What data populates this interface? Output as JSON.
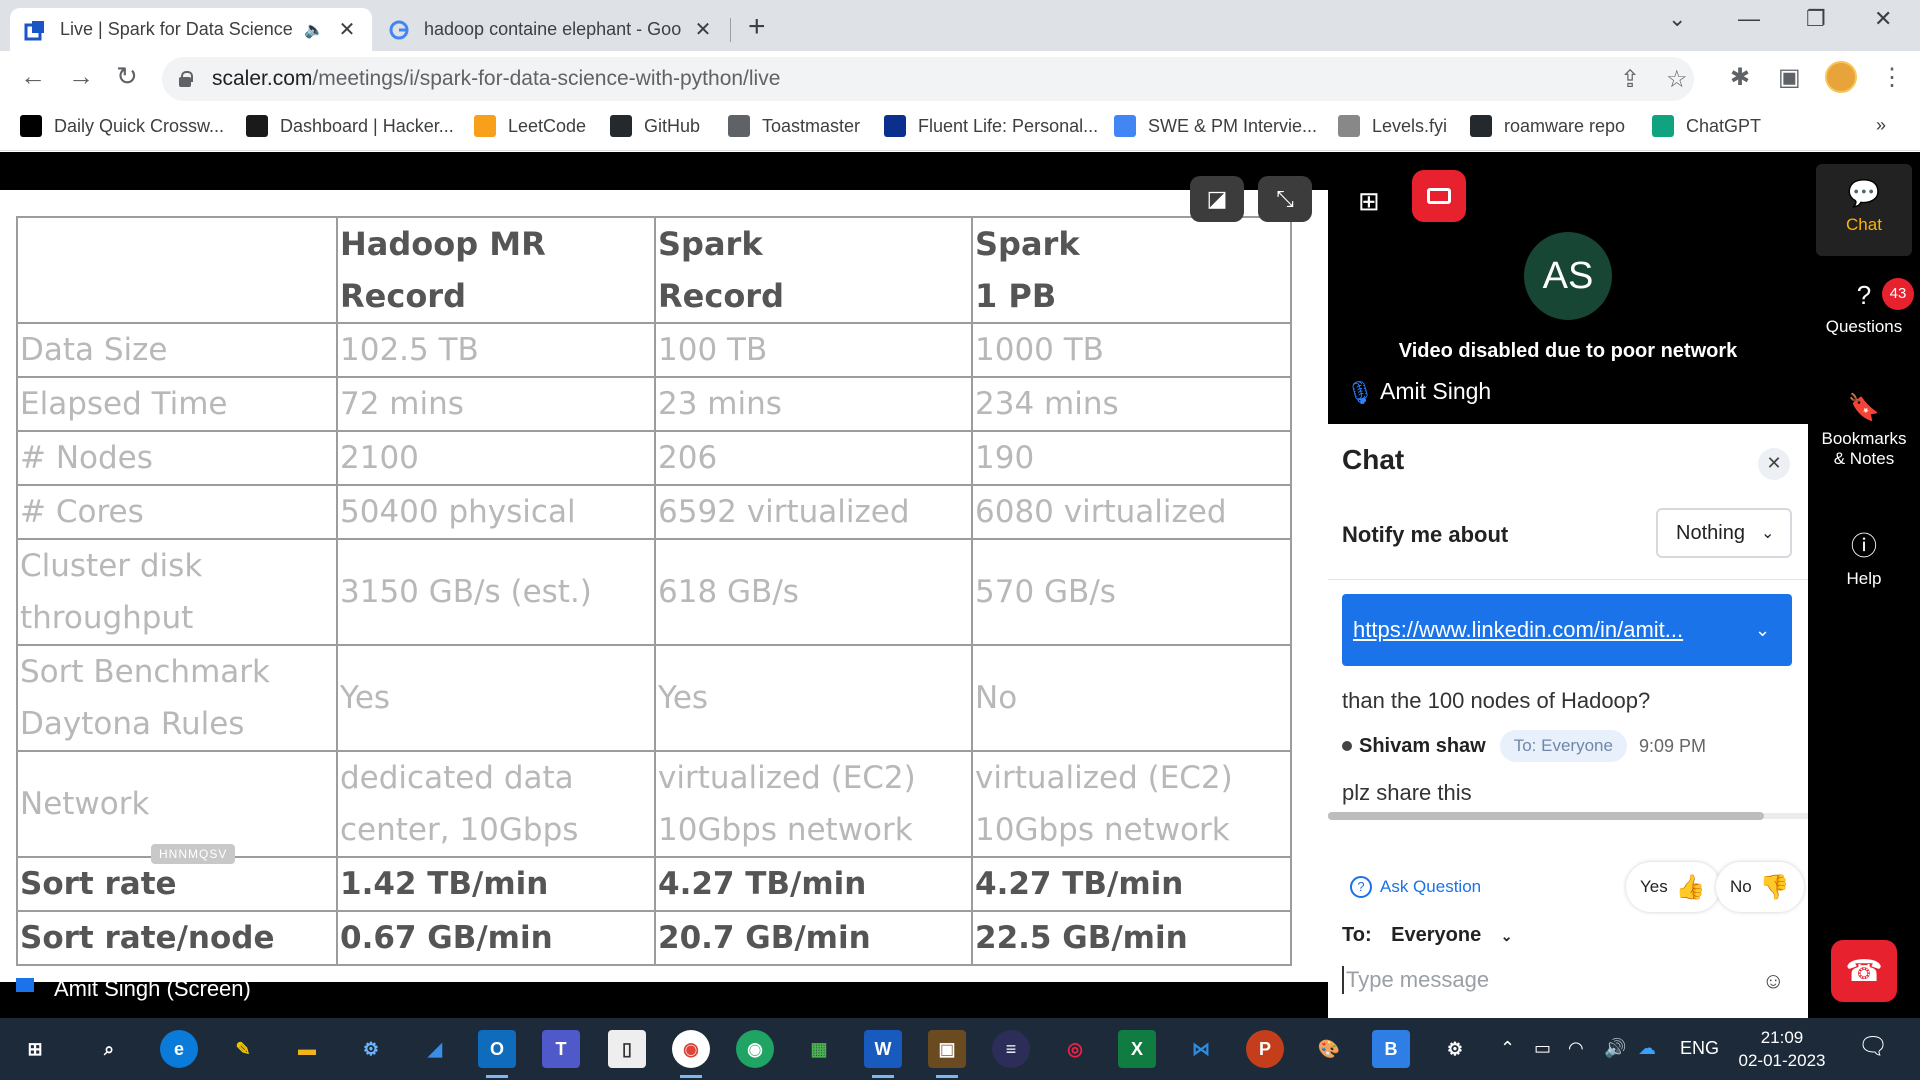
{
  "browser": {
    "tabs": [
      {
        "title": "Live | Spark for Data Science",
        "active": true
      },
      {
        "title": "hadoop containe elephant - Goo",
        "active": false
      }
    ],
    "url_host": "scaler.com",
    "url_path": "/meetings/i/spark-for-data-science-with-python/live",
    "bookmarks": [
      {
        "label": "Daily Quick Crossw...",
        "icon": "crossword-icon",
        "color": "#000000"
      },
      {
        "label": "Dashboard | Hacker...",
        "icon": "hackerrank-icon",
        "color": "#1a1a1a"
      },
      {
        "label": "LeetCode",
        "icon": "leetcode-icon",
        "color": "#f89f1b"
      },
      {
        "label": "GitHub",
        "icon": "github-icon",
        "color": "#24292e"
      },
      {
        "label": "Toastmaster",
        "icon": "globe-icon",
        "color": "#5f6368"
      },
      {
        "label": "Fluent Life: Personal...",
        "icon": "flag-icon",
        "color": "#0a2f8c"
      },
      {
        "label": "SWE & PM Intervie...",
        "icon": "docs-icon",
        "color": "#4285f4"
      },
      {
        "label": "Levels.fyi",
        "icon": "levels-icon",
        "color": "#888888"
      },
      {
        "label": "roamware repo",
        "icon": "octocat-icon",
        "color": "#24292e"
      },
      {
        "label": "ChatGPT",
        "icon": "chatgpt-icon",
        "color": "#10a37f"
      }
    ],
    "bookmarks_overflow": "»"
  },
  "slide": {
    "header": [
      "",
      "Hadoop MR\nRecord",
      "Spark\nRecord",
      "Spark\n1 PB"
    ],
    "rows": [
      [
        "Data Size",
        "102.5 TB",
        "100 TB",
        "1000 TB"
      ],
      [
        "Elapsed Time",
        "72 mins",
        "23 mins",
        "234 mins"
      ],
      [
        "# Nodes",
        "2100",
        "206",
        "190"
      ],
      [
        "# Cores",
        "50400 physical",
        "6592 virtualized",
        "6080 virtualized"
      ],
      [
        "Cluster disk throughput",
        "3150 GB/s (est.)",
        "618 GB/s",
        "570 GB/s"
      ],
      [
        "Sort Benchmark Daytona Rules",
        "Yes",
        "Yes",
        "No"
      ],
      [
        "Network",
        "dedicated data center, 10Gbps",
        "virtualized (EC2) 10Gbps network",
        "virtualized (EC2) 10Gbps network"
      ],
      [
        "Sort rate",
        "1.42 TB/min",
        "4.27 TB/min",
        "4.27 TB/min"
      ],
      [
        "Sort rate/node",
        "0.67 GB/min",
        "20.7 GB/min",
        "22.5 GB/min"
      ]
    ],
    "watermark": "HNNMQSV",
    "screen_label": "Amit Singh (Screen)"
  },
  "video": {
    "avatar_initials": "AS",
    "message": "Video disabled due to poor network",
    "participant": "Amit Singh"
  },
  "chat": {
    "title": "Chat",
    "notify_label": "Notify me about",
    "notify_value": "Nothing",
    "pinned_link": "https://www.linkedin.com/in/amit...",
    "prev_message_tail": "than the 100 nodes of Hadoop?",
    "message": {
      "author": "Shivam shaw",
      "to": "To: Everyone",
      "time": "9:09 PM",
      "text": "plz share this"
    },
    "ask_question": "Ask Question",
    "react_yes": "Yes",
    "react_no": "No",
    "to_label": "To:",
    "to_value": "Everyone",
    "composer_placeholder": "Type message"
  },
  "rail": {
    "chat": "Chat",
    "questions": "Questions",
    "questions_count": "43",
    "bookmarks": "Bookmarks & Notes",
    "help": "Help"
  },
  "taskbar": {
    "lang": "ENG",
    "time": "21:09",
    "date": "02-01-2023"
  }
}
